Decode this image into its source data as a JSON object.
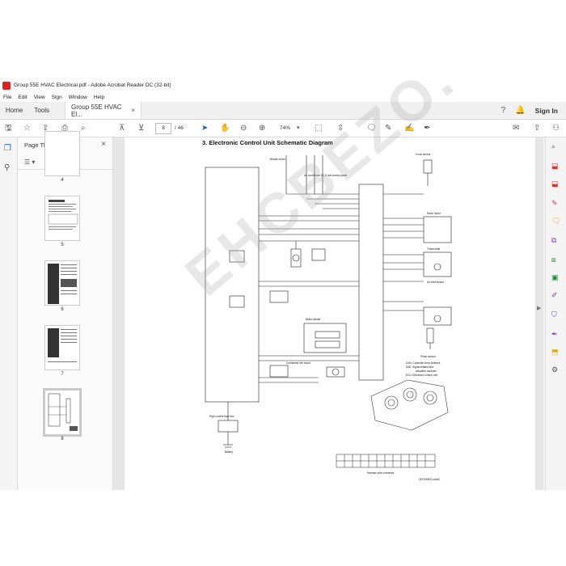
{
  "window": {
    "title": "Group 55E HVAC Electrical.pdf - Adobe Acrobat Reader DC (32-bit)"
  },
  "menu": [
    "File",
    "Edit",
    "View",
    "Sign",
    "Window",
    "Help"
  ],
  "tabs": {
    "home": "Home",
    "tools": "Tools",
    "document": "Group 55E HVAC El...",
    "close": "×"
  },
  "header": {
    "sign_in": "Sign In"
  },
  "toolbar": {
    "page_current": "8",
    "page_total": "/ 46",
    "zoom": "74%"
  },
  "thumbnails": {
    "title": "Page Thumbnails",
    "close": "×",
    "pages": [
      {
        "number": "4"
      },
      {
        "number": "5"
      },
      {
        "number": "6"
      },
      {
        "number": "7"
      },
      {
        "number": "8",
        "selected": true
      }
    ]
  },
  "document": {
    "heading": "3.  Electronic Control Unit Schematic Diagram",
    "labels": {
      "can_network": "CAN: Controller Area Network",
      "sae": "SAE: Signal-related and",
      "sae2": "actuation modules",
      "ecu": "ECU: Electronic control unit",
      "battery": "Battery",
      "photo_sensor": "Photo sensor",
      "harness": "Harness side connector",
      "footer_code": "OD7349ECU•AAC",
      "in_car_sensor": "In car sensor",
      "mode_motor": "Mode motor",
      "thermostat": "Thermostat",
      "air_inlet_sensor": "Air inlet sensor",
      "blower_motor": "Blower motor",
      "motor_cluster": "Motor cluster",
      "condenser_fan": "Condenser fan motor",
      "ac_ecu": "Air conditioner ECU unit control panel",
      "bl_fuse": "High current fuse box"
    }
  },
  "watermark": "EHCBEZO.COM"
}
